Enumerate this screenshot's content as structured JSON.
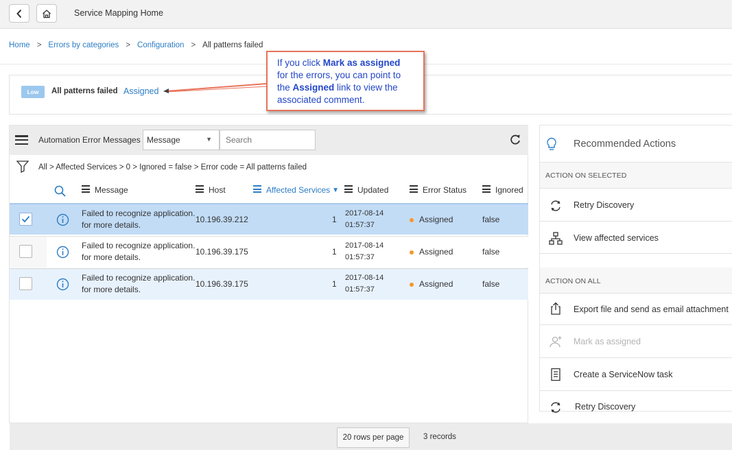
{
  "header": {
    "title": "Service Mapping Home",
    "back_icon": "chevron-left-icon",
    "home_icon": "home-icon"
  },
  "breadcrumb": {
    "items": [
      "Home",
      "Errors by categories",
      "Configuration"
    ],
    "current": "All patterns failed",
    "separator": ">"
  },
  "info": {
    "severity": "Low",
    "pattern": "All patterns failed",
    "assigned_link": "Assigned"
  },
  "callout": {
    "line1_pre": "If you click ",
    "line1_bold": "Mark as assigned",
    "line2": "for the errors, you can point to",
    "line3_pre": "the ",
    "line3_bold": "Assigned",
    "line3_post": " link to view the",
    "line4": "associated comment."
  },
  "list": {
    "title": "Automation Error Messages",
    "select_value": "Message",
    "search_placeholder": "Search",
    "filter": "All > Affected Services > 0 > Ignored = false > Error code = All patterns failed",
    "columns": [
      "Message",
      "Host",
      "Affected Services",
      "Updated",
      "Error Status",
      "Ignored"
    ],
    "sorted_column": "Affected Services",
    "rows": [
      {
        "checked": true,
        "msg1": "Failed to recognize application.",
        "msg2": "for more details.",
        "host": "10.196.39.212",
        "affected": "1",
        "date": "2017-08-14",
        "time": "01:57:37",
        "status": "Assigned",
        "ignored": "false"
      },
      {
        "checked": false,
        "msg1": "Failed to recognize application.",
        "msg2": "for more details.",
        "host": "10.196.39.175",
        "affected": "1",
        "date": "2017-08-14",
        "time": "01:57:37",
        "status": "Assigned",
        "ignored": "false"
      },
      {
        "checked": false,
        "msg1": "Failed to recognize application.",
        "msg2": "for more details.",
        "host": "10.196.39.175",
        "affected": "1",
        "date": "2017-08-14",
        "time": "01:57:37",
        "status": "Assigned",
        "ignored": "false"
      }
    ],
    "status_color": "#f5962b"
  },
  "footer": {
    "rows_per_page": "20 rows per page",
    "records": "3 records"
  },
  "recommended": {
    "title": "Recommended Actions",
    "section_selected": "ACTION ON SELECTED",
    "selected_actions": [
      {
        "label": "Retry Discovery",
        "icon": "refresh-icon"
      },
      {
        "label": "View affected services",
        "icon": "hierarchy-icon"
      }
    ],
    "section_all": "ACTION ON ALL",
    "all_actions": [
      {
        "label": "Export file and send as email attachment",
        "icon": "export-icon",
        "disabled": false
      },
      {
        "label": "Mark as assigned",
        "icon": "assign-user-icon",
        "disabled": true
      },
      {
        "label": "Create a ServiceNow task",
        "icon": "document-icon",
        "disabled": false
      },
      {
        "label": "Retry Discovery",
        "icon": "refresh-icon",
        "disabled": false
      }
    ]
  },
  "colors": {
    "link": "#2d7dc4",
    "callout_border": "#e8735a",
    "callout_text": "#2246c7",
    "selected_row": "#c2dcf6",
    "badge": "#9cc8ee"
  }
}
